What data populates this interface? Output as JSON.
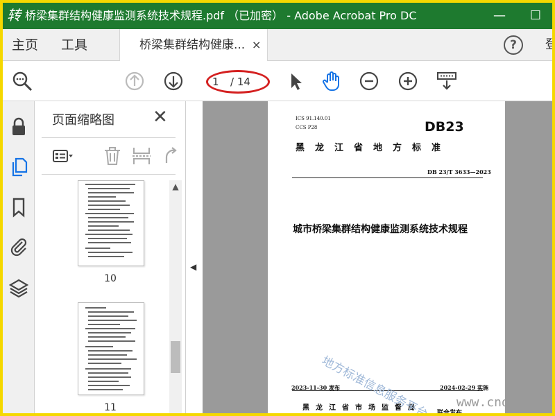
{
  "window": {
    "title": "桥梁集群结构健康监测系统技术规程.pdf （已加密） - Adobe Acrobat Pro DC",
    "minimize": "—",
    "maximize": "☐"
  },
  "menubar": {
    "home": "主页",
    "tools": "工具",
    "doc_tab": "桥梁集群结构健康...",
    "doc_tab_close": "×",
    "help": "?",
    "cut_item": "登"
  },
  "toolbar": {
    "current_page": "1",
    "total_pages": "/ 14"
  },
  "panel": {
    "title": "页面缩略图",
    "close": "✕",
    "scroll_up": "▲",
    "thumbnails": [
      {
        "label": "10"
      },
      {
        "label": "11"
      }
    ]
  },
  "document": {
    "ics": "ICS  91.140.01",
    "ccs": "CCS  P28",
    "db_logo": "DB23",
    "province": "黑龙江省地方标准",
    "standard_no": "DB 23/T  3633—2023",
    "doc_title": "城市桥梁集群结构健康监测系统技术规程",
    "publish_date": "2023-11-30 发布",
    "implement_date": "2024-02-29 实施",
    "issuer": "黑龙江省市场监督局",
    "joint_publish": "联合发布"
  },
  "overlay": {
    "watermark": "地方标准信息服务平台",
    "site_mark": "www.cnd",
    "logo": "转"
  },
  "colors": {
    "titlebar": "#1e7a2f",
    "highlight_ring": "#d42020",
    "active_tool": "#1473e6",
    "frame_border": "#f5d800"
  },
  "icons": {
    "rail": [
      "lock-icon",
      "pages-icon",
      "bookmark-icon",
      "attachment-icon",
      "layers-icon"
    ],
    "toolbar": [
      "zoom-search-icon",
      "prev-page-icon",
      "next-page-icon",
      "select-arrow-icon",
      "hand-tool-icon",
      "zoom-out-icon",
      "zoom-in-icon",
      "keyboard-tool-icon"
    ]
  }
}
